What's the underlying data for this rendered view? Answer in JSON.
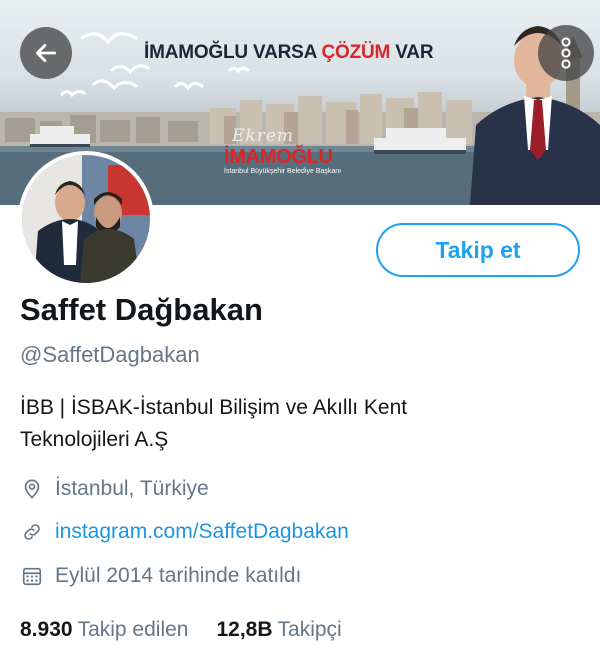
{
  "banner": {
    "headline_part1": "İMAMOĞLU VARSA ",
    "headline_accent": "ÇÖZÜM",
    "headline_part2": " VAR",
    "brand_script": "Ekrem",
    "brand_name": "İMAMOĞLU",
    "brand_sub": "İstanbul Büyükşehir Belediye Başkanı",
    "accent_color": "#d8262b"
  },
  "nav": {
    "back_icon": "arrow-left-icon",
    "more_icon": "more-vertical-icon"
  },
  "profile": {
    "display_name": "Saffet Dağbakan",
    "handle": "@SaffetDagbakan",
    "bio_line1": "İBB | İSBAK-İstanbul Bilişim ve Akıllı Kent",
    "bio_line2": "Teknolojileri A.Ş",
    "location": "İstanbul, Türkiye",
    "website": "instagram.com/SaffetDagbakan",
    "joined": "Eylül 2014 tarihinde katıldı",
    "follow_label": "Takip et",
    "following_count": "8.930",
    "following_label": "Takip edilen",
    "followers_count": "12,8B",
    "followers_label": "Takipçi"
  },
  "colors": {
    "link": "#1b95e0",
    "button": "#1da1f2",
    "secondary_text": "#657786"
  }
}
